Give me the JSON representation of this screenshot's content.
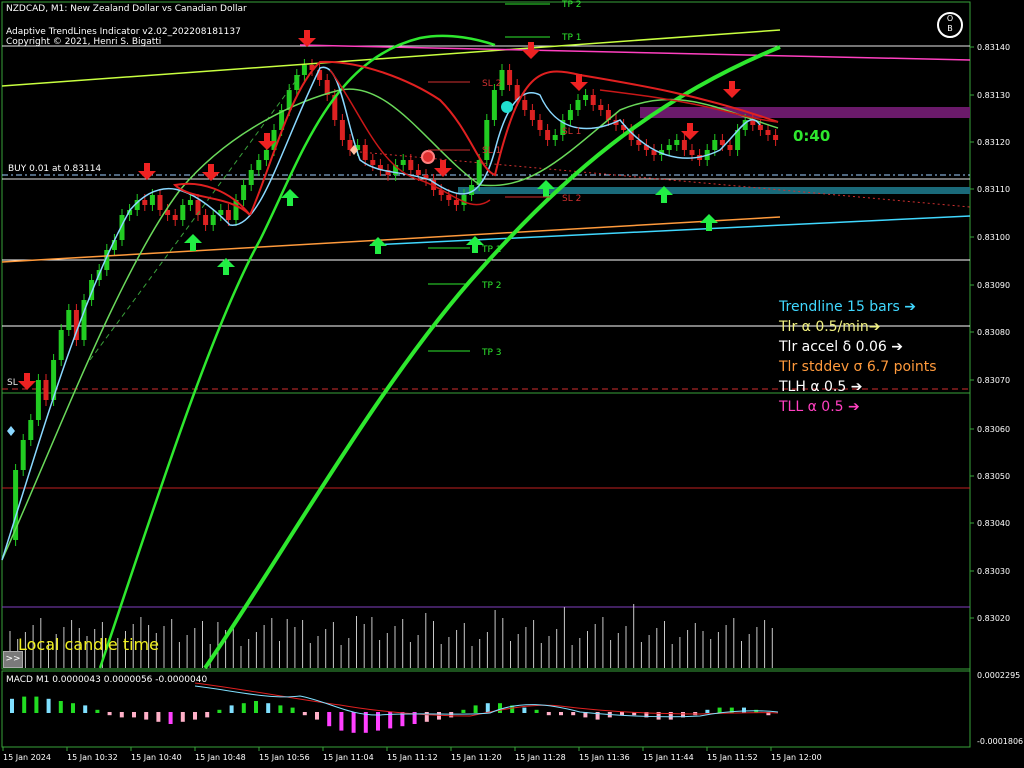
{
  "header": {
    "symbol_line": "NZDCAD, M1:  New Zealand Dollar vs Canadian Dollar",
    "indicator_title": "Adaptive TrendLines Indicator v2.02_202208181137",
    "copyright": "Copyright © 2021, Henri S. Bigatti"
  },
  "logo": {
    "top": "O",
    "bottom": "B"
  },
  "countdown": "0:40",
  "position_label": "BUY 0.01 at 0.83114",
  "sl_left_label": "SL",
  "local_candle_time": "Local candle time",
  "expand_button": ">>",
  "macd_label": "MACD M1 0.0000043 0.0000056 -0.0000040",
  "level_labels": {
    "tp2_top": "TP 2",
    "tp1_top": "TP 1",
    "sl2_top": "SL 2",
    "sl1": "SL 1",
    "sl_small": "SL 1",
    "sl2": "SL 2",
    "tp1": "TP 1",
    "tp2": "TP 2",
    "tp3": "TP 3"
  },
  "legend": [
    {
      "text": "Trendline 15 bars ➔",
      "color": "#40d8ff"
    },
    {
      "text": "Tlr α 0.5/min➔",
      "color": "#f0f080"
    },
    {
      "text": "Tlr accel δ 0.06 ➔",
      "color": "#ffffff"
    },
    {
      "text": "Tlr stddev σ 6.7 points",
      "color": "#ff9a3c"
    },
    {
      "text": "TLH α 0.5  ➔",
      "color": "#ffffff"
    },
    {
      "text": "TLL α 0.5  ➔",
      "color": "#ff40c0"
    }
  ],
  "price_axis": [
    "0.83140",
    "0.83130",
    "0.83120",
    "0.83110",
    "0.83100",
    "0.83090",
    "0.83080",
    "0.83070",
    "0.83060",
    "0.83050",
    "0.83040",
    "0.83030",
    "0.83020"
  ],
  "macd_axis": [
    "0.0002295",
    "-0.0001806"
  ],
  "time_axis": [
    "15 Jan 2024",
    "15 Jan 10:32",
    "15 Jan 10:40",
    "15 Jan 10:48",
    "15 Jan 10:56",
    "15 Jan 11:04",
    "15 Jan 11:12",
    "15 Jan 11:20",
    "15 Jan 11:28",
    "15 Jan 11:36",
    "15 Jan 11:44",
    "15 Jan 11:52",
    "15 Jan 12:00"
  ],
  "colors": {
    "bull": "#22cc22",
    "bear": "#dd2222",
    "trendline": "#40d8ff",
    "tlh": "#ff40c0",
    "tlr": "#c8ff40",
    "buy_arrow": "#22ee44",
    "sell_arrow": "#ee2222",
    "volume": "#c8c8c8",
    "macd_pos": "#22dd22",
    "macd_neg": "#ff40ff"
  }
}
